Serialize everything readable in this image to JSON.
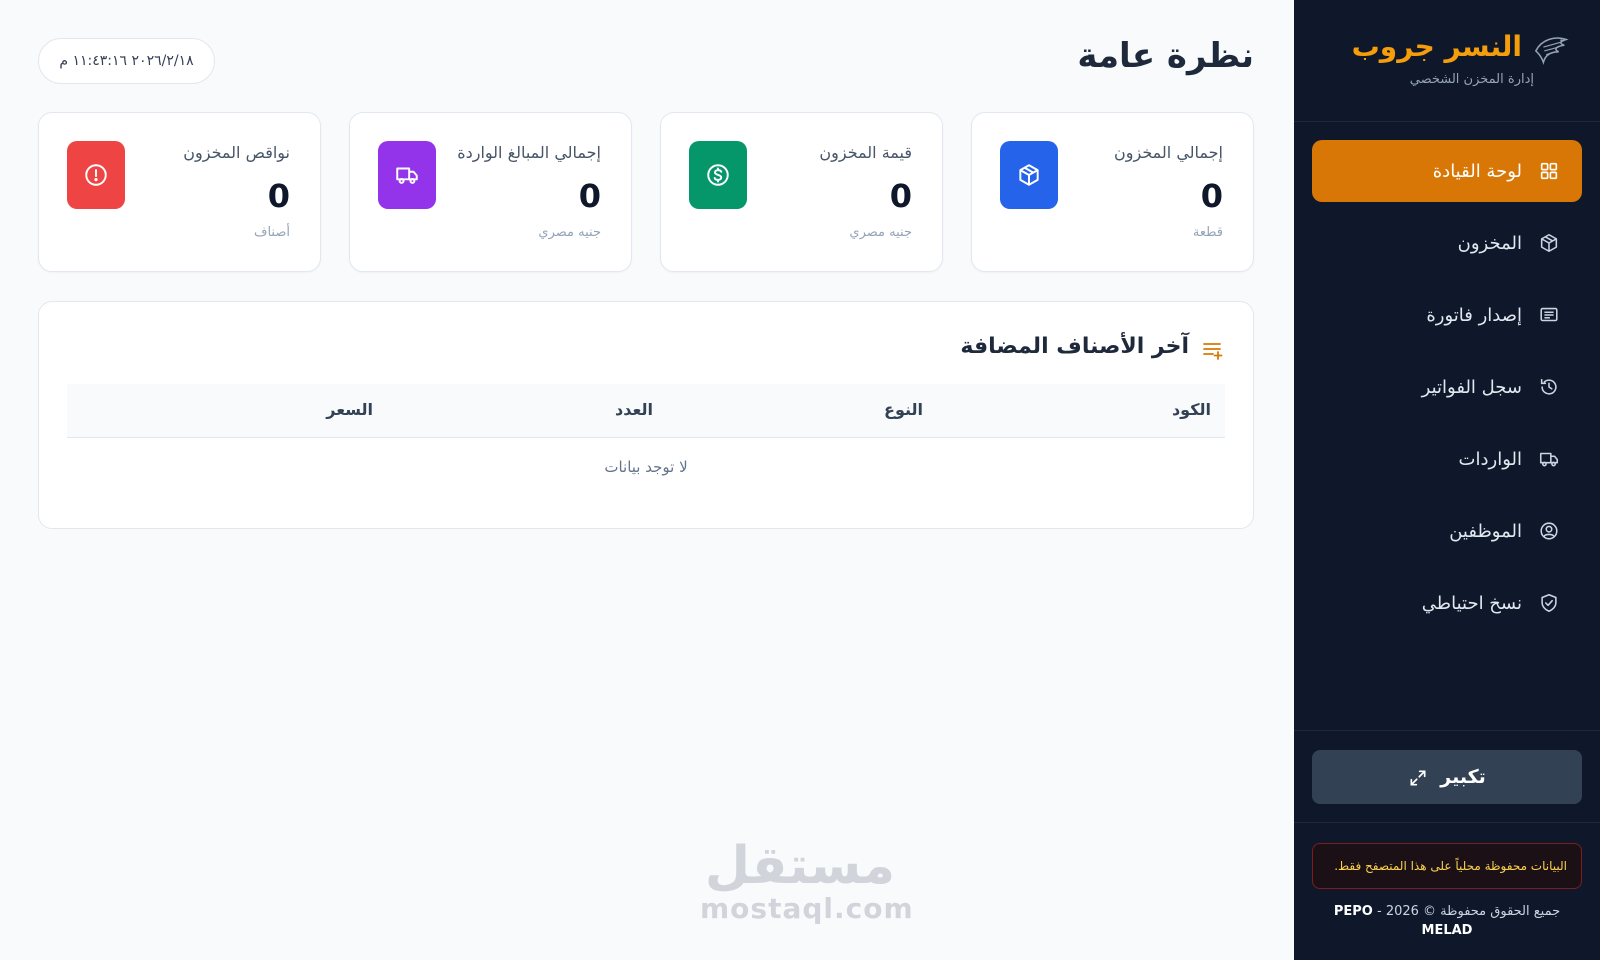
{
  "sidebar": {
    "brand_name": "النسر جروب",
    "brand_subtitle": "إدارة المخزن الشخصي",
    "logo_icon": "eagle-logo-icon",
    "items": [
      {
        "label": "لوحة القيادة",
        "icon": "grid-icon",
        "active": true
      },
      {
        "label": "المخزون",
        "icon": "box-icon",
        "active": false
      },
      {
        "label": "إصدار فاتورة",
        "icon": "invoice-icon",
        "active": false
      },
      {
        "label": "سجل الفواتير",
        "icon": "history-icon",
        "active": false
      },
      {
        "label": "الواردات",
        "icon": "truck-icon",
        "active": false
      },
      {
        "label": "الموظفين",
        "icon": "user-circle-icon",
        "active": false
      },
      {
        "label": "نسخ احتياطي",
        "icon": "shield-check-icon",
        "active": false
      }
    ],
    "expand_label": "تكبير",
    "storage_notice": "البيانات محفوظة محلياً على هذا المتصفح فقط.",
    "copyright_text": "جميع الحقوق محفوظة © 2026 - ",
    "copyright_brand": "PEPO",
    "copyright_name": "MELAD"
  },
  "header": {
    "title": "نظرة عامة",
    "datetime": "٢٠٢٦/٢/١٨ ١١:٤٣:١٦ م"
  },
  "stats": [
    {
      "label": "إجمالي المخزون",
      "value": "0",
      "unit": "قطعة",
      "icon": "box-icon",
      "color": "#2563eb"
    },
    {
      "label": "قيمة المخزون",
      "value": "0",
      "unit": "جنيه مصري",
      "icon": "dollar-circle-icon",
      "color": "#059669"
    },
    {
      "label": "إجمالي المبالغ الواردة",
      "value": "0",
      "unit": "جنيه مصري",
      "icon": "truck-icon",
      "color": "#9333ea"
    },
    {
      "label": "نواقص المخزون",
      "value": "0",
      "unit": "أصناف",
      "icon": "alert-circle-icon",
      "color": "#ef4444"
    }
  ],
  "recent": {
    "title": "آخر الأصناف المضافة",
    "columns": [
      "الكود",
      "النوع",
      "العدد",
      "السعر"
    ],
    "empty_text": "لا توجد بيانات"
  },
  "watermark": {
    "arabic": "مستقل",
    "latin": "mostaql.com"
  },
  "colors": {
    "sidebar_bg": "#0f172a",
    "accent": "#d97706",
    "brand": "#f59e0b"
  }
}
